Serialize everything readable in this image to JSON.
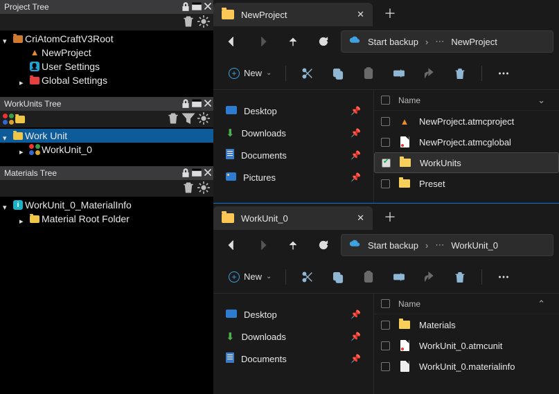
{
  "panels": [
    {
      "title": "Project Tree",
      "tree": [
        {
          "label": "CriAtomCraftV3Root",
          "icon": "folder-orange",
          "arrow": "down",
          "indent": 0
        },
        {
          "label": "NewProject",
          "icon": "tri-orange",
          "arrow": "",
          "indent": 1
        },
        {
          "label": "User Settings",
          "icon": "blue-man",
          "arrow": "",
          "indent": 1
        },
        {
          "label": "Global Settings",
          "icon": "folder-red",
          "arrow": "right",
          "indent": 1
        }
      ]
    },
    {
      "title": "WorkUnits Tree",
      "show_filter_icon": true,
      "show_quad_icon": true,
      "tree": [
        {
          "label": "Work Unit",
          "icon": "folder-yellow",
          "arrow": "down",
          "indent": 0,
          "selected": true
        },
        {
          "label": "WorkUnit_0",
          "icon": "quad",
          "arrow": "right",
          "indent": 1
        }
      ]
    },
    {
      "title": "Materials Tree",
      "tree": [
        {
          "label": "WorkUnit_0_MaterialInfo",
          "icon": "info-cyan",
          "arrow": "down",
          "indent": 0
        },
        {
          "label": "Material Root Folder",
          "icon": "folder-yellow",
          "arrow": "right",
          "indent": 1
        }
      ]
    }
  ],
  "new_label": "New",
  "name_col": "Name",
  "explorers": [
    {
      "tab_title": "NewProject",
      "breadcrumb_action": "Start backup",
      "breadcrumb_tail": "NewProject",
      "nav_items": [
        "Desktop",
        "Downloads",
        "Documents",
        "Pictures"
      ],
      "files": [
        {
          "name": "NewProject.atmcproject",
          "icon": "tri",
          "checked": false
        },
        {
          "name": "NewProject.atmcglobal",
          "icon": "doc-red",
          "checked": false
        },
        {
          "name": "WorkUnits",
          "icon": "folder",
          "checked": true,
          "selected": true
        },
        {
          "name": "Preset",
          "icon": "folder",
          "checked": false
        }
      ],
      "sort_dir": "down"
    },
    {
      "tab_title": "WorkUnit_0",
      "breadcrumb_action": "Start backup",
      "breadcrumb_tail": "WorkUnit_0",
      "nav_items": [
        "Desktop",
        "Downloads",
        "Documents"
      ],
      "files": [
        {
          "name": "Materials",
          "icon": "folder",
          "checked": false
        },
        {
          "name": "WorkUnit_0.atmcunit",
          "icon": "doc-red",
          "checked": false
        },
        {
          "name": "WorkUnit_0.materialinfo",
          "icon": "doc-plain",
          "checked": false
        }
      ],
      "sort_dir": "up"
    }
  ]
}
